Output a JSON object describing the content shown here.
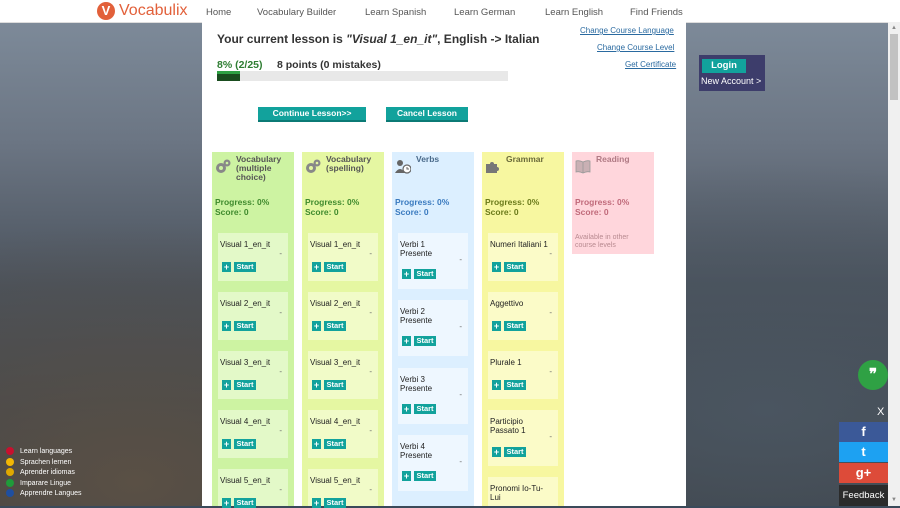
{
  "app": {
    "logo_mark": "V",
    "name": "Vocabulix"
  },
  "nav": [
    "Home",
    "Vocabulary Builder",
    "Learn Spanish",
    "Learn German",
    "Learn English",
    "Find Friends"
  ],
  "lesson": {
    "title_prefix": "Your current lesson is ",
    "title_name": "\"Visual 1_en_it\"",
    "title_suffix": ", English -> Italian",
    "progress_pct": "8% (2/25)",
    "progress_fraction": 0.08,
    "points": "8 points (0 mistakes)",
    "continue_label": "Continue Lesson>>",
    "cancel_label": "Cancel Lesson"
  },
  "links": {
    "change_language": "Change Course Language",
    "change_level": "Change Course Level",
    "certificate": "Get Certificate"
  },
  "categories": {
    "vocab_mc": {
      "title": "Vocabulary (multiple choice)",
      "icon": "gears-icon",
      "color": "#cdf3a2",
      "progress": "Progress: 0%",
      "score": "Score: 0",
      "items": [
        "Visual 1_en_it",
        "Visual 2_en_it",
        "Visual 3_en_it",
        "Visual 4_en_it",
        "Visual 5_en_it"
      ]
    },
    "vocab_sp": {
      "title": "Vocabulary (spelling)",
      "icon": "gears-icon",
      "color": "#e5f7a2",
      "progress": "Progress: 0%",
      "score": "Score: 0",
      "items": [
        "Visual 1_en_it",
        "Visual 2_en_it",
        "Visual 3_en_it",
        "Visual 4_en_it",
        "Visual 5_en_it"
      ]
    },
    "verbs": {
      "title": "Verbs",
      "icon": "person-clock-icon",
      "color": "#dcefff",
      "progress": "Progress: 0%",
      "score": "Score: 0",
      "items": [
        "Verbi 1 Presente",
        "Verbi 2 Presente",
        "Verbi 3 Presente",
        "Verbi 4 Presente"
      ]
    },
    "grammar": {
      "title": "Grammar",
      "icon": "puzzle-icon",
      "color": "#f7f7a0",
      "progress": "Progress: 0%",
      "score": "Score: 0",
      "items": [
        "Numeri Italiani 1",
        "Aggettivo",
        "Plurale 1",
        "Participio Passato 1",
        "Pronomi Io-Tu-Lui"
      ]
    },
    "reading": {
      "title": "Reading",
      "icon": "book-icon",
      "color": "#ffd6dc",
      "progress": "Progress: 0%",
      "score": "Score: 0",
      "note": "Available in other course levels"
    }
  },
  "card": {
    "plus": "+",
    "start": "Start",
    "dash": "-"
  },
  "login": {
    "button": "Login",
    "new_account": "New Account >"
  },
  "languages": [
    {
      "label": "Learn languages",
      "color": "#c8102e"
    },
    {
      "label": "Sprachen lernen",
      "color": "#f2b705"
    },
    {
      "label": "Aprender idiomas",
      "color": "#e0a800"
    },
    {
      "label": "Imparare Lingue",
      "color": "#1f9b3a"
    },
    {
      "label": "Apprendre Langues",
      "color": "#1f4fa0"
    }
  ],
  "widgets": {
    "chat": "❞",
    "close": "X",
    "facebook": "f",
    "twitter": "t",
    "googleplus": "g+",
    "feedback": "Feedback",
    "colors": {
      "facebook": "#3b5998",
      "twitter": "#1da1f2",
      "googleplus": "#dd4b39"
    }
  }
}
